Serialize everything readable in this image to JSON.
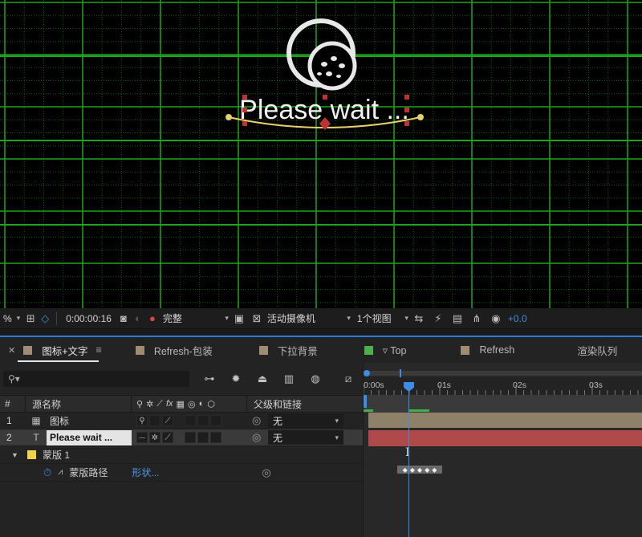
{
  "viewer": {
    "canvas_text": "Please wait ...",
    "zoom_suffix": "%",
    "timecode": "0:00:00:16",
    "resolution": "完整",
    "camera": "活动摄像机",
    "views": "1个视图",
    "exposure": "+0.0"
  },
  "tabs": [
    {
      "label": "图标+文字",
      "color": "#a08c72",
      "active": true
    },
    {
      "label": "Refresh-包装",
      "color": "#a08c72"
    },
    {
      "label": "下拉背景",
      "color": "#a08c72"
    },
    {
      "label": "▿ Top",
      "color": "#4cb04c"
    },
    {
      "label": "Refresh",
      "color": "#a08c72"
    },
    {
      "label": "渲染队列",
      "color": ""
    }
  ],
  "timeline": {
    "search_placeholder": "⚲▾",
    "columns": {
      "num": "#",
      "name": "源名称",
      "parent": "父级和链接"
    },
    "layers": [
      {
        "num": "1",
        "name": "图标",
        "parent": "无",
        "type": "precomp"
      },
      {
        "num": "2",
        "name": "Please wait ...",
        "parent": "无",
        "type": "text"
      }
    ],
    "mask": {
      "name": "蒙版 1",
      "path_label": "蒙版路径",
      "path_value": "形状..."
    },
    "ruler": {
      "labels": [
        "0:00s",
        "01s",
        "02s",
        "03s"
      ]
    }
  }
}
